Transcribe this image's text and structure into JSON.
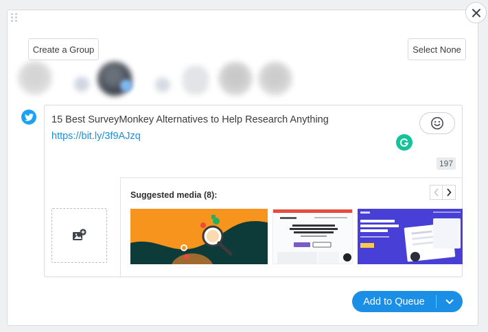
{
  "modal": {
    "create_group_label": "Create a Group",
    "select_none_label": "Select None",
    "close_icon": "close-icon",
    "drag_icon": "drag-handle-icon"
  },
  "profiles": {
    "network_icon": "twitter-icon",
    "network_color": "#1da1f2"
  },
  "composer": {
    "post_text": "15 Best SurveyMonkey Alternatives to Help Research Anything",
    "post_link": "https://bit.ly/3f9AJzq",
    "char_count": "197",
    "emoji_icon": "emoji-icon",
    "grammarly_color": "#15c39a",
    "link_color": "#1c8fd8"
  },
  "media": {
    "upload_icon": "add-image-icon",
    "suggested_title": "Suggested media (8):",
    "thumbnails": [
      {
        "name": "survey-illustration"
      },
      {
        "name": "wpforms-screenshot"
      },
      {
        "name": "pluto-screenshot"
      }
    ]
  },
  "footer": {
    "add_to_queue_label": "Add to Queue",
    "accent_color": "#1a8fe5"
  }
}
